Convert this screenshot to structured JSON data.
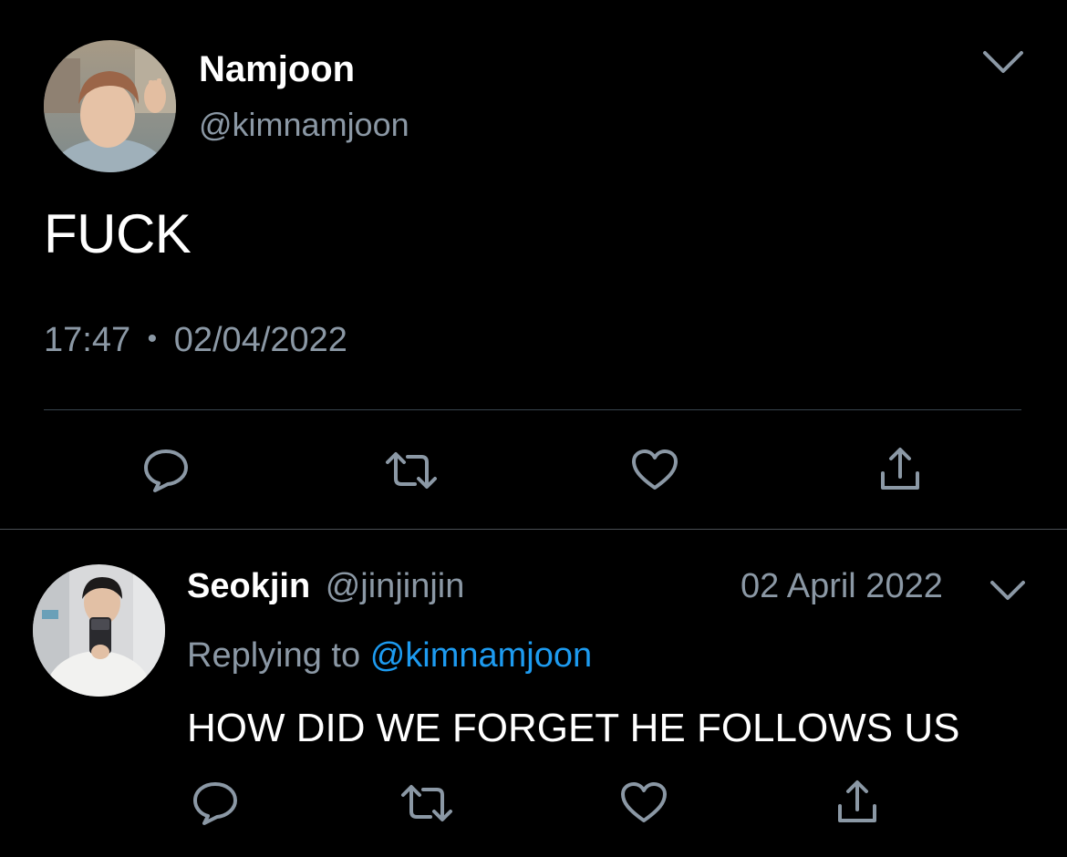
{
  "main_tweet": {
    "display_name": "Namjoon",
    "handle": "@kimnamjoon",
    "text": "FUCK",
    "time": "17:47",
    "separator": "•",
    "date": "02/04/2022",
    "avatar_icon": "profile-photo",
    "menu_icon": "chevron-down-icon",
    "actions": [
      {
        "name": "reply",
        "icon": "reply-bubble-icon"
      },
      {
        "name": "retweet",
        "icon": "retweet-icon"
      },
      {
        "name": "like",
        "icon": "heart-icon"
      },
      {
        "name": "share",
        "icon": "share-icon"
      }
    ]
  },
  "reply_tweet": {
    "display_name": "Seokjin",
    "handle": "@jinjinjin",
    "date": "02 April 2022",
    "replying_prefix": "Replying to",
    "replying_handle": "@kimnamjoon",
    "text": "HOW DID WE FORGET HE FOLLOWS US",
    "avatar_icon": "profile-photo",
    "menu_icon": "chevron-down-icon",
    "actions": [
      {
        "name": "reply",
        "icon": "reply-bubble-icon"
      },
      {
        "name": "retweet",
        "icon": "retweet-icon"
      },
      {
        "name": "like",
        "icon": "heart-icon"
      },
      {
        "name": "share",
        "icon": "share-icon"
      }
    ]
  },
  "colors": {
    "background": "#000000",
    "primary_text": "#ffffff",
    "secondary_text": "#8b98a5",
    "mention": "#1d9bf0",
    "divider": "#38444d"
  }
}
